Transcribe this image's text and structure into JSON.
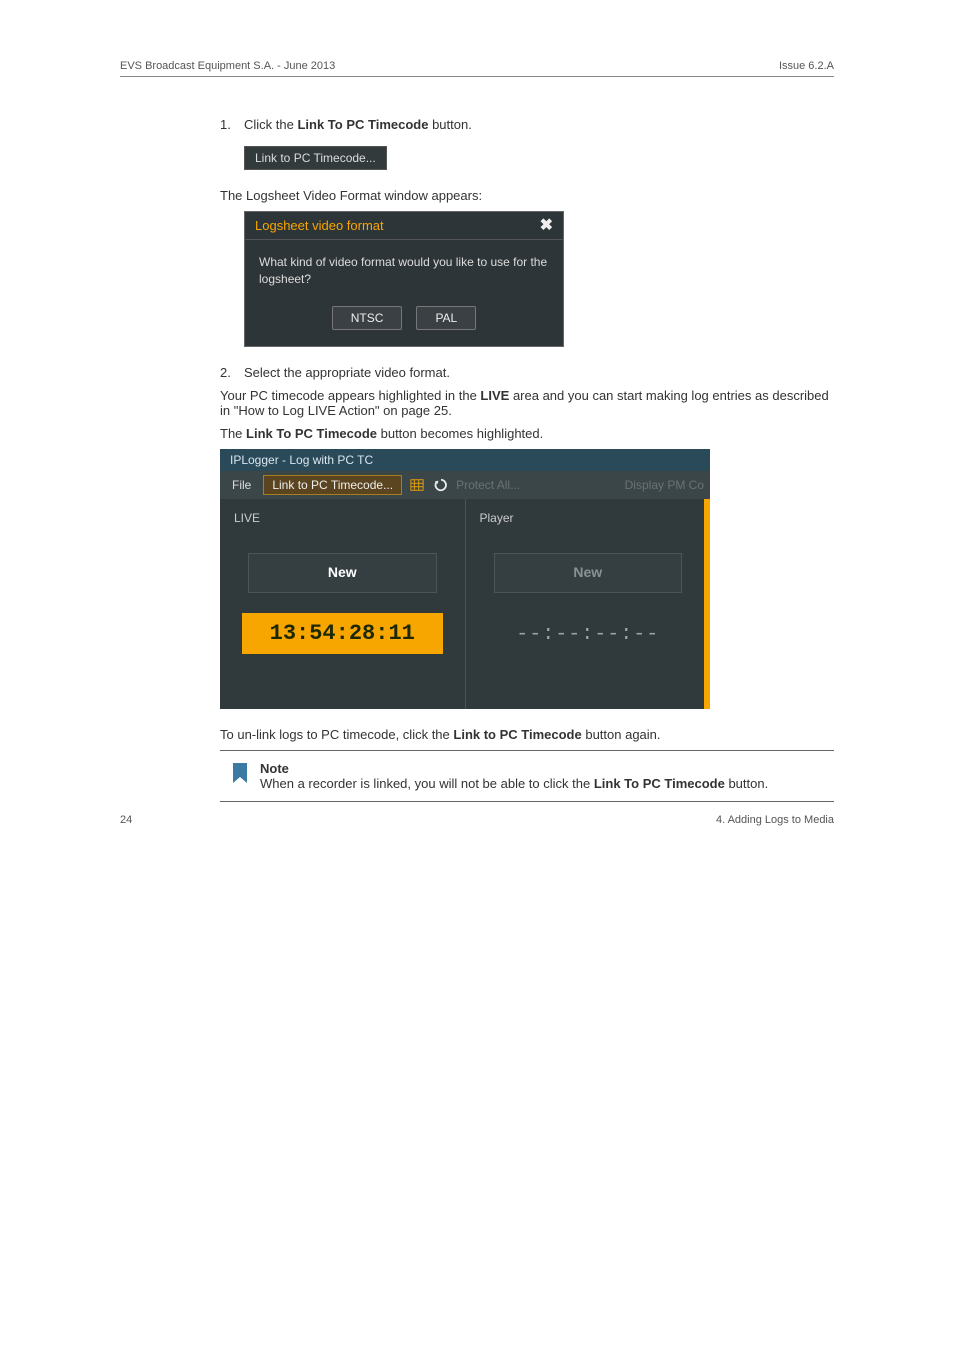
{
  "header": {
    "left": "EVS Broadcast Equipment S.A. - June 2013",
    "right": "Issue 6.2.A"
  },
  "steps": {
    "s1": {
      "num": "1.",
      "text_before": "Click the ",
      "bold": "Link To PC Timecode",
      "text_after": " button."
    },
    "s2": {
      "num": "2.",
      "text": "Select the appropriate video format."
    }
  },
  "link_button_label": "Link to PC Timecode...",
  "after_btn_img": "The Logsheet Video Format window appears:",
  "dialog": {
    "title": "Logsheet video format",
    "body": "What kind of video format would you like to use for the logsheet?",
    "btn_ntsc": "NTSC",
    "btn_pal": "PAL"
  },
  "para_live": {
    "a": "Your PC timecode appears highlighted in the ",
    "b": "LIVE",
    "c": " area and you can start making log entries as described in \"How to Log LIVE Action\" on page 25."
  },
  "para_highlighted": {
    "a": "The ",
    "b": "Link To PC Timecode",
    "c": " button becomes highlighted."
  },
  "app": {
    "title": "IPLogger - Log with PC TC",
    "file": "File",
    "link_btn": "Link to PC Timecode...",
    "protect_all": "Protect All...",
    "display_pm": "Display PM Co",
    "live_label": "LIVE",
    "player_label": "Player",
    "new_label": "New",
    "timecode": "13:54:28:11",
    "empty_tc": "--:--:--:--"
  },
  "para_unlink": {
    "a": "To un-link logs to PC timecode, click the ",
    "b": "Link to PC Timecode",
    "c": " button again."
  },
  "note": {
    "title": "Note",
    "body_a": "When a recorder is linked, you will not be able to click the ",
    "body_b": "Link To PC Timecode",
    "body_c": " button."
  },
  "footer": {
    "page": "24",
    "section": "4. Adding Logs to Media"
  }
}
